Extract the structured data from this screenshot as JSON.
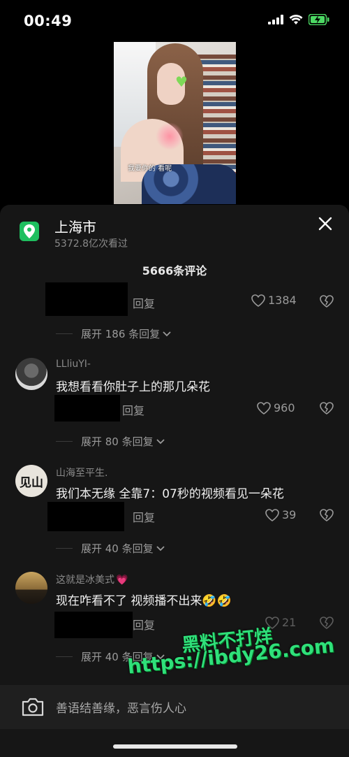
{
  "status_bar": {
    "time": "00:49"
  },
  "video": {
    "caption": "我要你的 看呢"
  },
  "sheet": {
    "location_title": "上海市",
    "location_views": "5372.8亿次看过",
    "comment_count": "5666条评论",
    "input_placeholder": "善语结善缘，恶言伤人心"
  },
  "comments": [
    {
      "reply_label": "回复",
      "likes": "1384",
      "expand": "展开 186 条回复"
    },
    {
      "username": "LLliuYI-",
      "text": "我想看看你肚子上的那几朵花",
      "reply_label": "回复",
      "likes": "960",
      "expand": "展开 80 条回复"
    },
    {
      "username": "山海至平生.",
      "text": "我们本无缘 全靠7：07秒的视频看见一朵花",
      "reply_label": "回复",
      "likes": "39",
      "expand": "展开 40 条回复"
    },
    {
      "username": "这就是冰美式",
      "username_emoji": "💗",
      "text": "现在咋看不了 视频播不出来",
      "text_emoji": "🤣🤣",
      "reply_label": "回复",
      "likes": "21",
      "expand": "展开 40 条回复"
    }
  ],
  "watermark": {
    "line1": "黑料不打烊",
    "line2": "https://ibdy26.com"
  },
  "colors": {
    "sheet_bg": "#161616",
    "location_green": "#1fbf5f",
    "watermark_green": "#2fe07a"
  }
}
